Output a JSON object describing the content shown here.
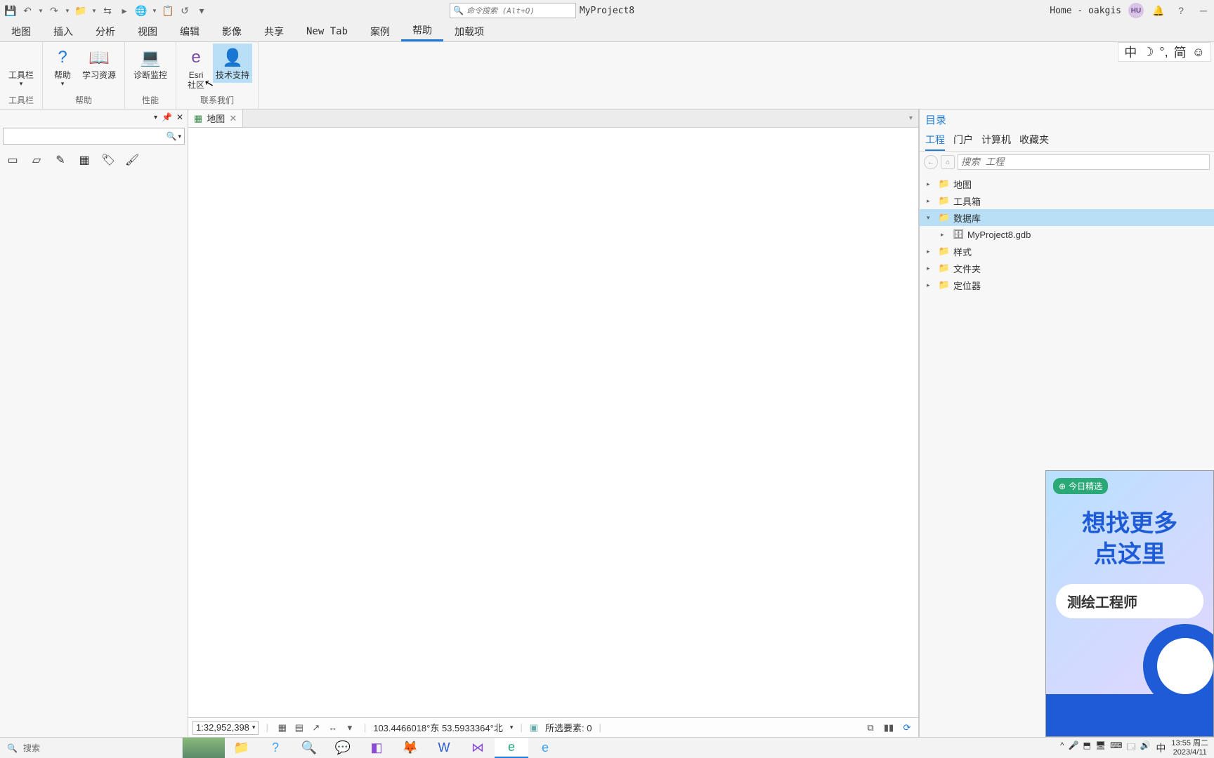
{
  "qat_icons": [
    "save",
    "undo",
    "redo",
    "folder",
    "switch",
    "present",
    "globe",
    "paste",
    "history",
    "more"
  ],
  "project_name": "MyProject8",
  "command_search_placeholder": "命令搜索 (Alt+Q)",
  "user": {
    "label": "Home - oakgis",
    "initials": "HU"
  },
  "title_icons": [
    "bell",
    "help",
    "minimize"
  ],
  "tabs": [
    "地图",
    "插入",
    "分析",
    "视图",
    "编辑",
    "影像",
    "共享",
    "New Tab",
    "案例",
    "帮助",
    "加载项"
  ],
  "active_tab": "帮助",
  "ribbon_groups": [
    {
      "label": "工具栏",
      "items": [
        {
          "label": "工具栏",
          "icon": "",
          "dd": true
        }
      ]
    },
    {
      "label": "帮助",
      "items": [
        {
          "label": "帮助",
          "icon": "?",
          "dd": true,
          "color": "#1e7ad6"
        },
        {
          "label": "学习资源",
          "icon": "📖"
        }
      ]
    },
    {
      "label": "性能",
      "items": [
        {
          "label": "诊断监控",
          "icon": "💻"
        }
      ]
    },
    {
      "label": "联系我们",
      "items": [
        {
          "label": "Esri\n社区",
          "icon": "e",
          "color": "#7a4aa6"
        },
        {
          "label": "技术支持",
          "icon": "👤",
          "highlight": true,
          "color": "#1e7ad6"
        }
      ]
    }
  ],
  "ime": [
    "中",
    "☽",
    "°,",
    "简",
    "☺"
  ],
  "left_tools": [
    "▭",
    "▱",
    "✎",
    "▦",
    "🏷",
    "🖌"
  ],
  "left_first_item": "",
  "map_tab": {
    "label": "地图"
  },
  "map_status": {
    "scale": "1:32,952,398",
    "coords": "103.4466018°东 53.5933364°北",
    "selection": "所选要素: 0",
    "btns": [
      "▦",
      "▤",
      "↗",
      "↔",
      "▾"
    ],
    "trailbtns": [
      "⧉",
      "▮▮",
      "⟳"
    ]
  },
  "catalog": {
    "title": "目录",
    "tabs": [
      "工程",
      "门户",
      "计算机",
      "收藏夹"
    ],
    "active": "工程",
    "search_placeholder": "搜索 工程",
    "tree": [
      {
        "label": "地图",
        "open": false
      },
      {
        "label": "工具箱",
        "open": false
      },
      {
        "label": "数据库",
        "open": true,
        "sel": true,
        "children": [
          {
            "label": "MyProject8.gdb",
            "gdb": true
          }
        ]
      },
      {
        "label": "样式",
        "open": false
      },
      {
        "label": "文件夹",
        "open": false
      },
      {
        "label": "定位器",
        "open": false
      }
    ]
  },
  "ad": {
    "tag": "今日精选",
    "line1": "想找更多",
    "line2": "点这里",
    "pill": "测绘工程师"
  },
  "taskbar": {
    "search": "搜索",
    "apps": [
      {
        "name": "file-explorer",
        "color": "#f7c35a",
        "glyph": "📁"
      },
      {
        "name": "help",
        "color": "#3aa0f0",
        "glyph": "?"
      },
      {
        "name": "search",
        "color": "#f0a030",
        "glyph": "🔍"
      },
      {
        "name": "wechat",
        "color": "#59c96a",
        "glyph": "💬"
      },
      {
        "name": "app-purple",
        "color": "#8a4ad6",
        "glyph": "◧"
      },
      {
        "name": "firefox",
        "color": "#f06a2a",
        "glyph": "🦊"
      },
      {
        "name": "word",
        "color": "#2a5ad6",
        "glyph": "W"
      },
      {
        "name": "visual-studio",
        "color": "#8a4ad6",
        "glyph": "⋈"
      },
      {
        "name": "edge",
        "color": "#1da876",
        "glyph": "e",
        "active": true
      },
      {
        "name": "ie",
        "color": "#3aa0f0",
        "glyph": "e"
      }
    ],
    "tray_icons": [
      "^",
      "🎤",
      "⬒",
      "🖥",
      "⌨",
      "🗔",
      "🔊"
    ],
    "ime": "中",
    "time": "13:55 周二",
    "date": "2023/4/11"
  }
}
